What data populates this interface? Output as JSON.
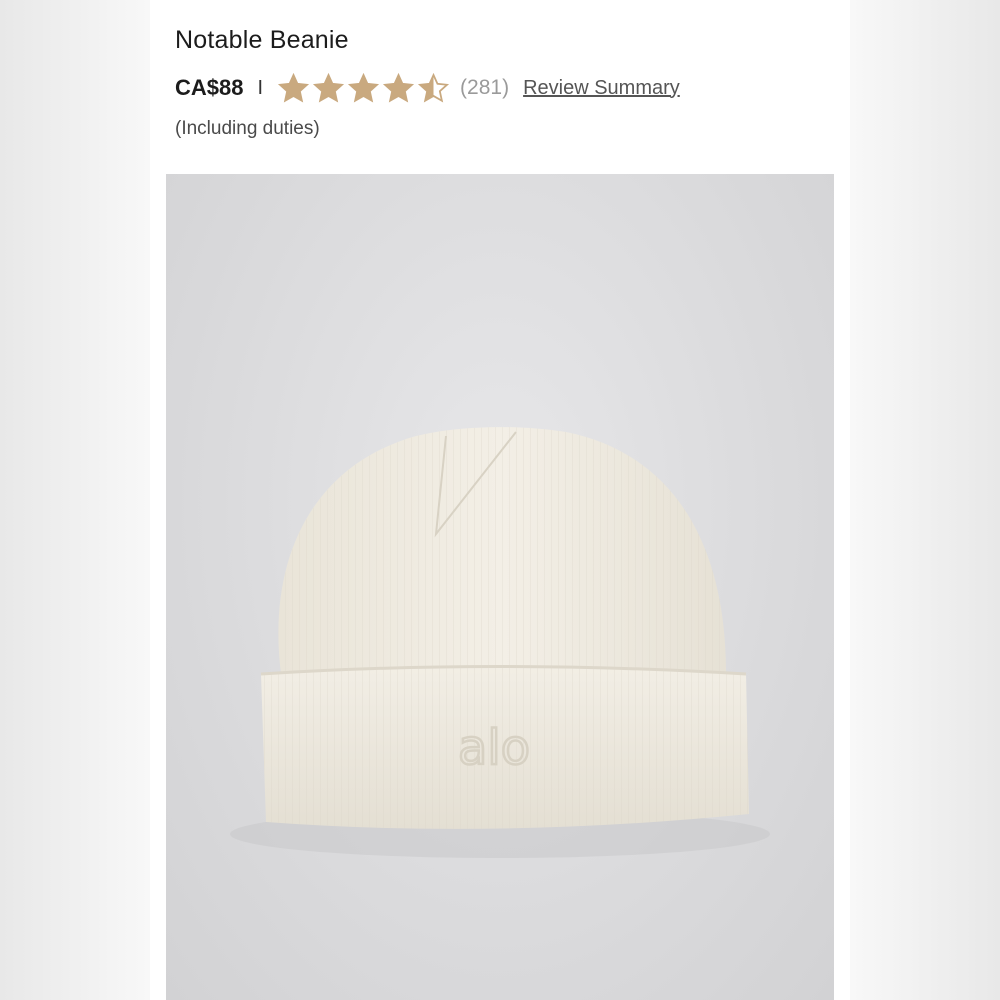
{
  "product": {
    "title": "Notable Beanie",
    "price": "CA$88",
    "separator": "I",
    "rating": 4.5,
    "rating_max": 5,
    "review_count": "(281)",
    "review_link_label": "Review Summary",
    "duties_note": "(Including duties)",
    "image": {
      "subject": "beanie",
      "logo_text": "alo"
    }
  },
  "colors": {
    "star": "#c9a97f",
    "text": "#1c1c1c",
    "muted": "#9a9a9a",
    "beanie": "#efebe1"
  }
}
